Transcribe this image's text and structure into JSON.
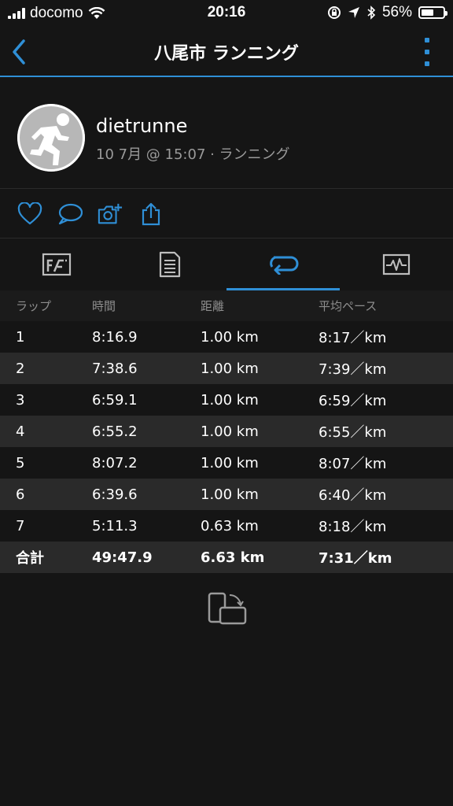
{
  "status_bar": {
    "carrier": "docomo",
    "time": "20:16",
    "battery": "56%",
    "battery_level": 0.56
  },
  "nav": {
    "title": "八尾市 ランニング",
    "accent_color": "#2f8fd6"
  },
  "profile": {
    "username": "dietrunne",
    "subtitle": "10 7月 @ 15:07 · ランニング"
  },
  "actions": [
    "heart-icon",
    "comment-icon",
    "add-photo-icon",
    "share-icon"
  ],
  "tabs": [
    "overview-icon",
    "details-icon",
    "laps-icon",
    "charts-icon"
  ],
  "active_tab": 2,
  "table": {
    "headers": [
      "ラップ",
      "時間",
      "距離",
      "平均ペース"
    ],
    "rows": [
      [
        "1",
        "8:16.9",
        "1.00 km",
        "8:17／km"
      ],
      [
        "2",
        "7:38.6",
        "1.00 km",
        "7:39／km"
      ],
      [
        "3",
        "6:59.1",
        "1.00 km",
        "6:59／km"
      ],
      [
        "4",
        "6:55.2",
        "1.00 km",
        "6:55／km"
      ],
      [
        "5",
        "8:07.2",
        "1.00 km",
        "8:07／km"
      ],
      [
        "6",
        "6:39.6",
        "1.00 km",
        "6:40／km"
      ],
      [
        "7",
        "5:11.3",
        "0.63 km",
        "8:18／km"
      ]
    ],
    "total": [
      "合計",
      "49:47.9",
      "6.63 km",
      "7:31／km"
    ]
  }
}
